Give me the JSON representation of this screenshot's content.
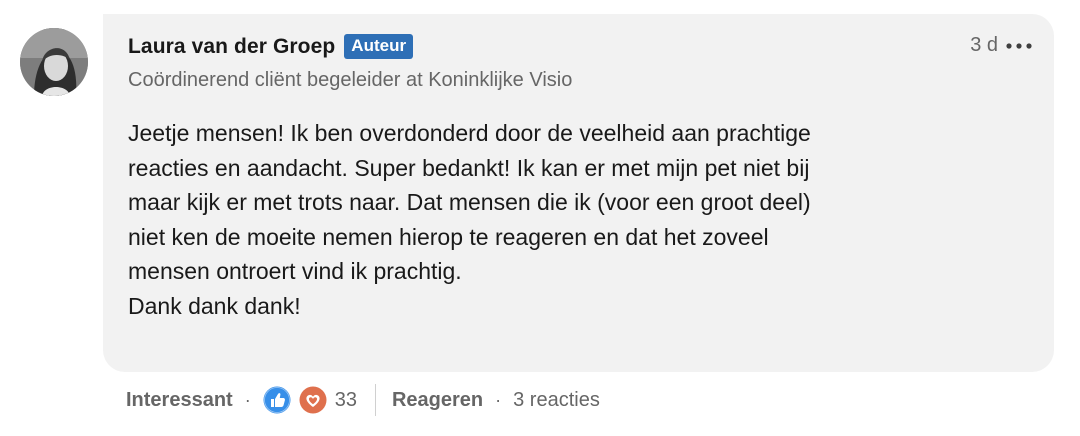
{
  "comment": {
    "author": {
      "name": "Laura van der Groep",
      "badge": "Auteur",
      "headline": "Coördinerend cliënt begeleider at Koninklijke Visio",
      "avatar": "profile-photo"
    },
    "time": "3 d",
    "more_icon": "ellipsis-icon",
    "body": [
      "Jeetje mensen! Ik ben overdonderd door de veelheid aan prachtige",
      "reacties en aandacht. Super bedankt! Ik kan er met mijn pet niet bij",
      "maar kijk er met trots naar. Dat mensen die ik (voor een groot deel)",
      "niet ken de moeite nemen hierop te reageren en dat het zoveel",
      "mensen ontroert vind ik prachtig.",
      "Dank dank dank!"
    ]
  },
  "actions": {
    "like_label": "Interessant",
    "separator": "·",
    "reaction_icons": [
      "thumbs-up-icon",
      "heart-icon"
    ],
    "reaction_count": "33",
    "reply_label": "Reageren",
    "replies_count_text": "3 reacties"
  },
  "colors": {
    "bubble": "#f2f2f2",
    "badge": "#2e6fb6",
    "like_blue": "#378fe9",
    "love_red": "#df704d",
    "muted_text": "#666666"
  }
}
